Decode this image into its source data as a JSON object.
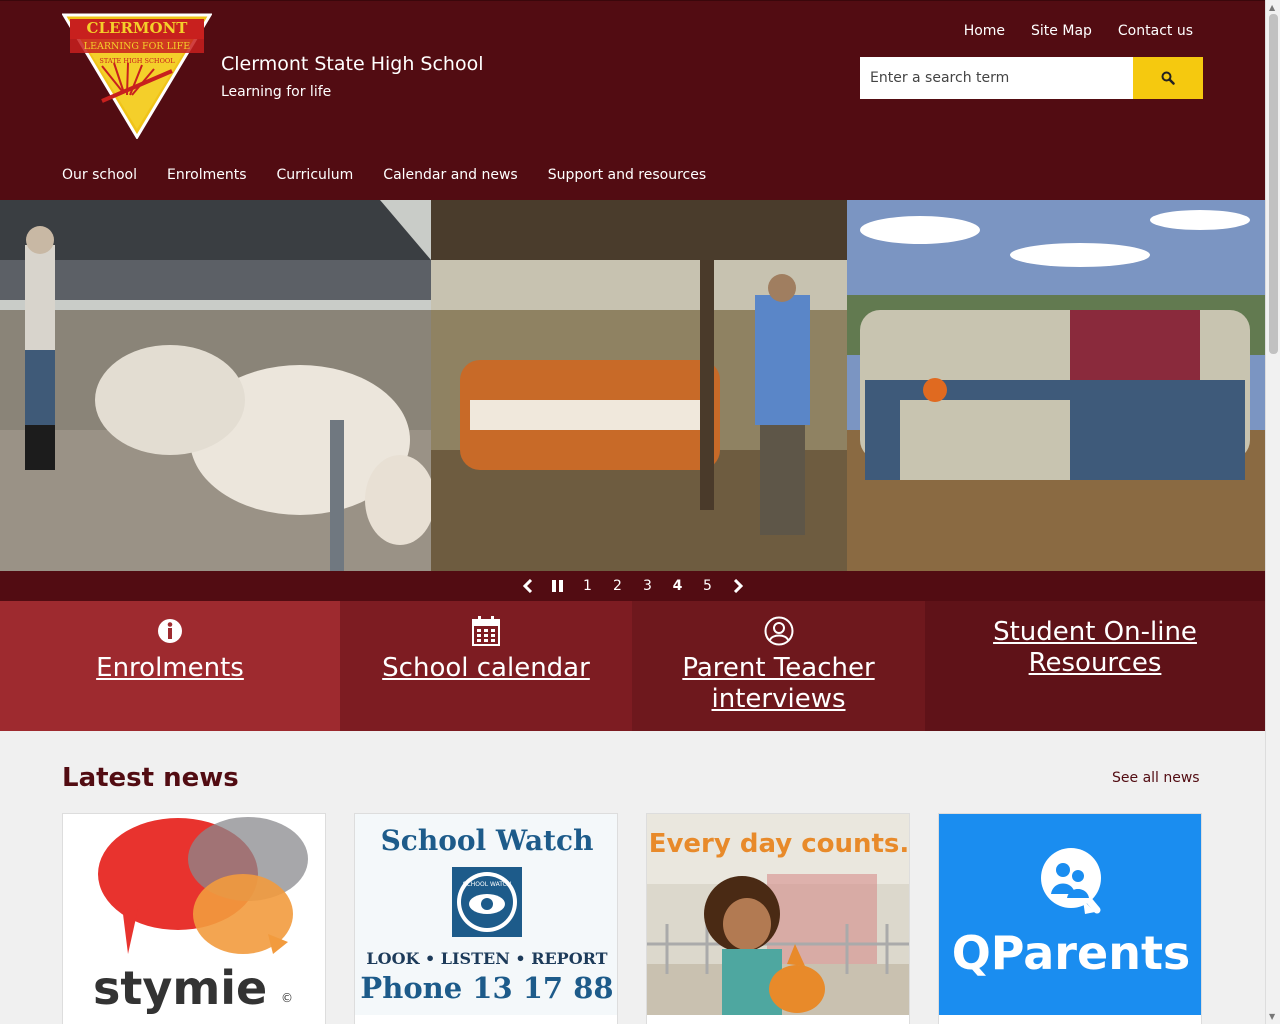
{
  "header": {
    "logo_text_top": "CLERMONT",
    "logo_text_motto": "LEARNING FOR LIFE",
    "logo_text_sub": "STATE HIGH SCHOOL",
    "site_name": "Clermont State High School",
    "tagline": "Learning for life",
    "util_nav": [
      "Home",
      "Site Map",
      "Contact us"
    ],
    "search_placeholder": "Enter a search term",
    "search_icon": "search-icon",
    "main_nav": [
      "Our school",
      "Enrolments",
      "Curriculum",
      "Calendar and news",
      "Support and resources"
    ]
  },
  "carousel": {
    "prev_icon": "chevron-left-icon",
    "pause_icon": "pause-icon",
    "next_icon": "chevron-right-icon",
    "pages": [
      "1",
      "2",
      "3",
      "4",
      "5"
    ],
    "active_page": "4"
  },
  "tiles": [
    {
      "label": "Enrolments",
      "icon": "info-icon"
    },
    {
      "label": "School calendar",
      "icon": "calendar-icon"
    },
    {
      "label": "Parent Teacher interviews",
      "icon": "user-circle-icon"
    },
    {
      "label": "Student On-line Resources",
      "icon": ""
    }
  ],
  "news": {
    "title": "Latest news",
    "see_all": "See all news",
    "cards": [
      {
        "image_text": "stymie",
        "image_mark": "©"
      },
      {
        "image_text": "School Watch",
        "image_badge": "SCHOOL WATCH",
        "image_line2": "LOOK • LISTEN • REPORT",
        "image_line3": "Phone 13 17 88"
      },
      {
        "image_text": "Every day counts."
      },
      {
        "image_text": "QParents"
      }
    ]
  },
  "colors": {
    "maroon": "#520c12",
    "yellow": "#f5c90f",
    "tile1": "#9e2a2f",
    "tile2": "#7d1c22",
    "tile3": "#6e181d",
    "tile4": "#5f1218"
  }
}
